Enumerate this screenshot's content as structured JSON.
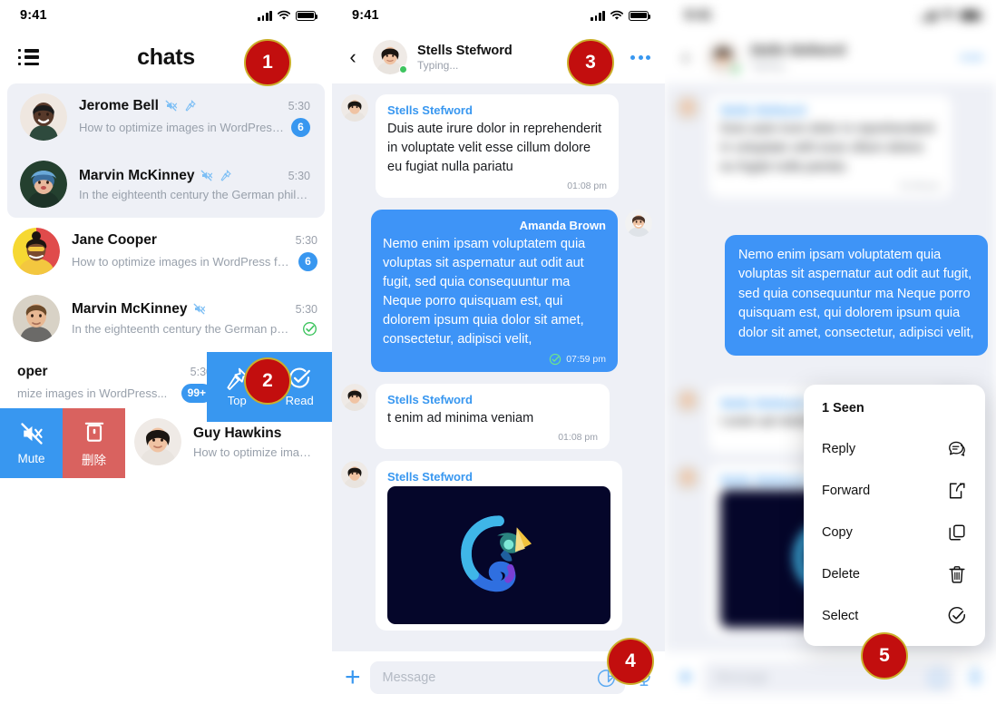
{
  "status_bar": {
    "time": "9:41",
    "signal_icon": "signal-bars-icon",
    "wifi_icon": "wifi-icon",
    "battery_icon": "battery-full-icon"
  },
  "left_panel": {
    "menu_icon": "list-menu-icon",
    "title": "chats",
    "rows": [
      {
        "name": "Jerome Bell",
        "preview": "How to optimize images in WordPress for...",
        "time": "5:30",
        "badge": "6",
        "muted": true,
        "pinned": true,
        "read": false,
        "selected": true
      },
      {
        "name": "Marvin McKinney",
        "preview": "In the eighteenth century the German philosoph...",
        "time": "5:30",
        "badge": "",
        "muted": true,
        "pinned": true,
        "read": false,
        "selected": true
      },
      {
        "name": "Jane Cooper",
        "preview": "How to optimize images in WordPress for...",
        "time": "5:30",
        "badge": "6",
        "muted": false,
        "pinned": false,
        "read": false,
        "selected": false
      },
      {
        "name": "Marvin McKinney",
        "preview": "In the eighteenth century the German philos...",
        "time": "5:30",
        "badge": "",
        "muted": true,
        "pinned": false,
        "read": true,
        "selected": false
      }
    ],
    "partial_row": {
      "name": "oper",
      "preview": "mize images in WordPress...",
      "time": "5:30",
      "badge": "99+"
    },
    "swipe_right_actions": [
      {
        "label": "Top",
        "icon": "pin-icon"
      },
      {
        "label": "Read",
        "icon": "check-circle-icon"
      }
    ],
    "swipe_left_actions": [
      {
        "label": "Mute",
        "icon": "mute-icon",
        "color": "#3897f0"
      },
      {
        "label": "删除",
        "icon": "trash-icon",
        "color": "#d9625f"
      }
    ],
    "bottom_row": {
      "name": "Guy Hawkins",
      "preview": "How to optimize images in W"
    }
  },
  "mid_panel": {
    "header": {
      "back_icon": "back-chevron-icon",
      "name": "Stells Stefword",
      "subtitle": "Typing...",
      "more_icon": "more-dots-icon",
      "online": true
    },
    "messages": [
      {
        "side": "them",
        "sender": "Stells Stefword",
        "text": "Duis aute irure dolor in reprehenderit in voluptate velit esse cillum dolore eu fugiat nulla pariatu",
        "time": "01:08 pm",
        "read_icon": ""
      },
      {
        "side": "me",
        "sender": "Amanda Brown",
        "text": "Nemo enim ipsam voluptatem quia voluptas sit aspernatur aut odit aut fugit, sed quia consequuntur ma Neque porro quisquam est, qui dolorem ipsum quia dolor sit amet, consectetur, adipisci velit,",
        "time": "07:59 pm",
        "read_icon": "check-circle-icon"
      },
      {
        "side": "them",
        "sender": "Stells Stefword",
        "text": "t enim ad minima veniam",
        "time": "01:08 pm",
        "read_icon": ""
      },
      {
        "side": "them",
        "sender": "Stells Stefword",
        "text": "",
        "attachment": "chameleon-logo-image",
        "time": "",
        "read_icon": ""
      }
    ],
    "composer": {
      "plus_icon": "plus-icon",
      "placeholder": "Message",
      "value": "",
      "sticker_icon": "sticker-icon",
      "mic_icon": "microphone-icon"
    }
  },
  "right_panel": {
    "highlighted_message": "Nemo enim ipsam voluptatem quia voluptas sit aspernatur aut odit aut fugit, sed quia consequuntur ma Neque porro quisquam est, qui dolorem ipsum quia dolor sit amet, consectetur, adipisci velit,",
    "context_menu": {
      "title": "1 Seen",
      "items": [
        {
          "label": "Reply",
          "icon": "reply-bubble-icon"
        },
        {
          "label": "Forward",
          "icon": "forward-share-icon"
        },
        {
          "label": "Copy",
          "icon": "copy-icon"
        },
        {
          "label": "Delete",
          "icon": "trash-icon"
        },
        {
          "label": "Select",
          "icon": "check-circle-icon"
        }
      ]
    }
  },
  "markers": [
    {
      "n": "1"
    },
    {
      "n": "2"
    },
    {
      "n": "3"
    },
    {
      "n": "4"
    },
    {
      "n": "5"
    }
  ],
  "colors": {
    "accent_blue": "#3897f0",
    "bubble_blue": "#3e94f7",
    "chat_bg": "#eef0f6",
    "delete_red": "#d9625f",
    "marker_red": "#c20e0e",
    "marker_ring": "#cbae2a",
    "green_check": "#3ec45f"
  }
}
